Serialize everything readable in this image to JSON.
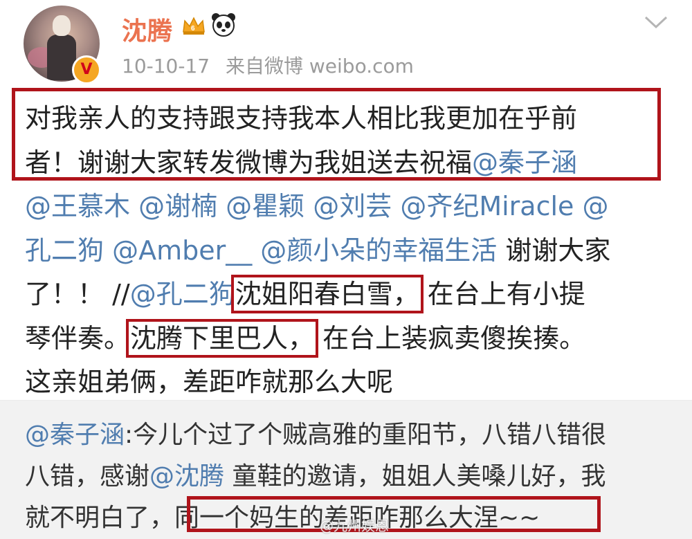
{
  "post": {
    "username": "沈腾",
    "meta": {
      "date": "10-10-17",
      "source": "来自微博 weibo.com"
    },
    "lines": [
      [
        "对我亲人的支持跟支持我本人相比我更加在乎前"
      ],
      [
        "者！谢谢大家转发微博为我姐送去祝福",
        "@秦子涵"
      ],
      [
        "@王慕木 @谢楠 @瞿颖 @刘芸 @齐纪Miracle @"
      ],
      [
        "孔二狗 @Amber__ @颜小朵的幸福生活",
        " 谢谢大家"
      ],
      [
        "了！！ //",
        "@孔二狗",
        "沈姐阳春白雪，",
        " 在台上有小提"
      ],
      [
        "琴伴奏。",
        "沈腾下里巴人，",
        " 在台上装疯卖傻挨揍。"
      ],
      [
        "这亲姐弟俩，差距咋就那么大呢"
      ]
    ]
  },
  "repost": {
    "lines": [
      [
        "@秦子涵",
        ":今儿个过了个贼高雅的重阳节，八错八错很"
      ],
      [
        "八错，感谢",
        "@沈腾",
        " 童鞋的邀请，姐姐人美嗓儿好，我"
      ],
      [
        "就不明白了，",
        "同一个妈生的差距咋那么大涅~~"
      ]
    ]
  },
  "watermark": "@九州娱恩",
  "colors": {
    "username": "#eb7350",
    "mention": "#507daf",
    "highlight_box": "#b0141b",
    "repost_bg": "#f2f2f2",
    "meta": "#9b9b9b"
  },
  "icons": [
    "avatar",
    "verified-badge-icon",
    "crown-vip-icon",
    "panda-icon",
    "chevron-down-icon"
  ]
}
